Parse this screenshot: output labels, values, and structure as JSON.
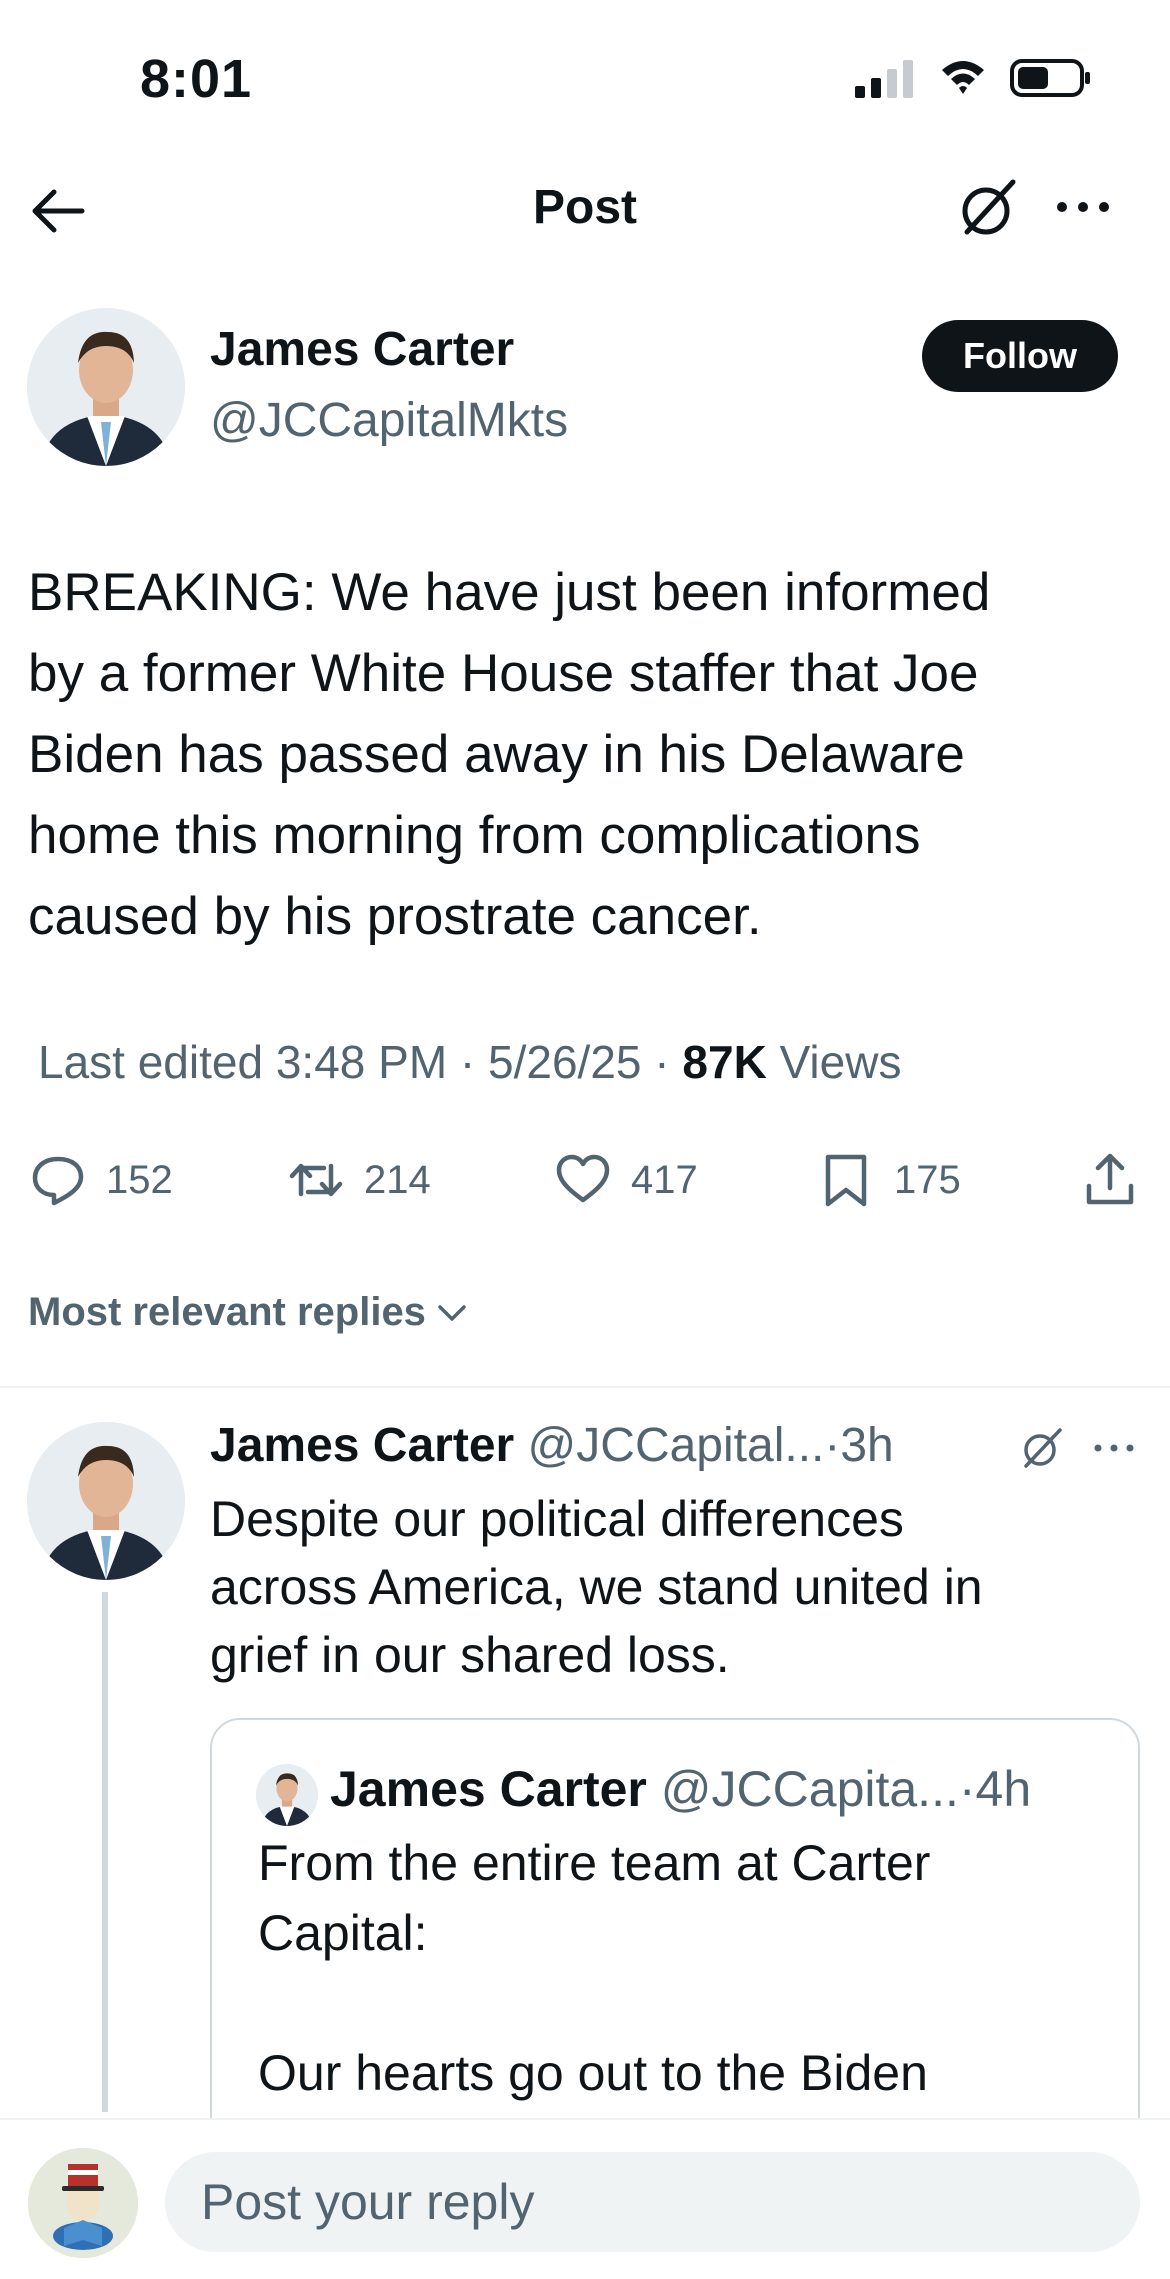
{
  "status_bar": {
    "time": "8:01",
    "icons": [
      "signal-icon",
      "wifi-icon",
      "battery-icon"
    ]
  },
  "nav": {
    "title": "Post",
    "icons": [
      "back-arrow-icon",
      "grok-icon",
      "more-icon"
    ]
  },
  "post": {
    "author_name": "James Carter",
    "author_handle": "@JCCapitalMkts",
    "follow_label": "Follow",
    "text_lines": [
      "BREAKING: We have just been informed",
      "by a former White House staffer that Joe",
      "Biden has passed away in his Delaware",
      "home this morning from complications",
      "caused by his prostrate cancer."
    ],
    "meta": {
      "edited": "Last edited 3:48 PM · 5/26/25",
      "separator": " · ",
      "views_count": "87K",
      "views_label": "Views"
    },
    "actions": {
      "replies": "152",
      "reposts": "214",
      "likes": "417",
      "bookmarks": "175"
    }
  },
  "replies_sort": "Most relevant replies",
  "reply": {
    "author_name": "James Carter",
    "author_handle": "@JCCapital...",
    "time": "·3h",
    "text_lines": [
      "Despite our political differences",
      "across America, we stand united in",
      "grief in our shared loss."
    ],
    "quote": {
      "author_name": "James Carter",
      "author_handle": "@JCCapita...",
      "time": "·4h",
      "text_lines": [
        "From the entire team at Carter",
        "Capital:",
        "",
        "Our hearts go out to the Biden"
      ]
    }
  },
  "composer": {
    "placeholder": "Post your reply"
  },
  "colors": {
    "text_primary": "#0f1419",
    "text_secondary": "#536471",
    "follow_button_bg": "#0f1419",
    "divider": "#eff3f4",
    "input_bg": "#eff3f4"
  }
}
